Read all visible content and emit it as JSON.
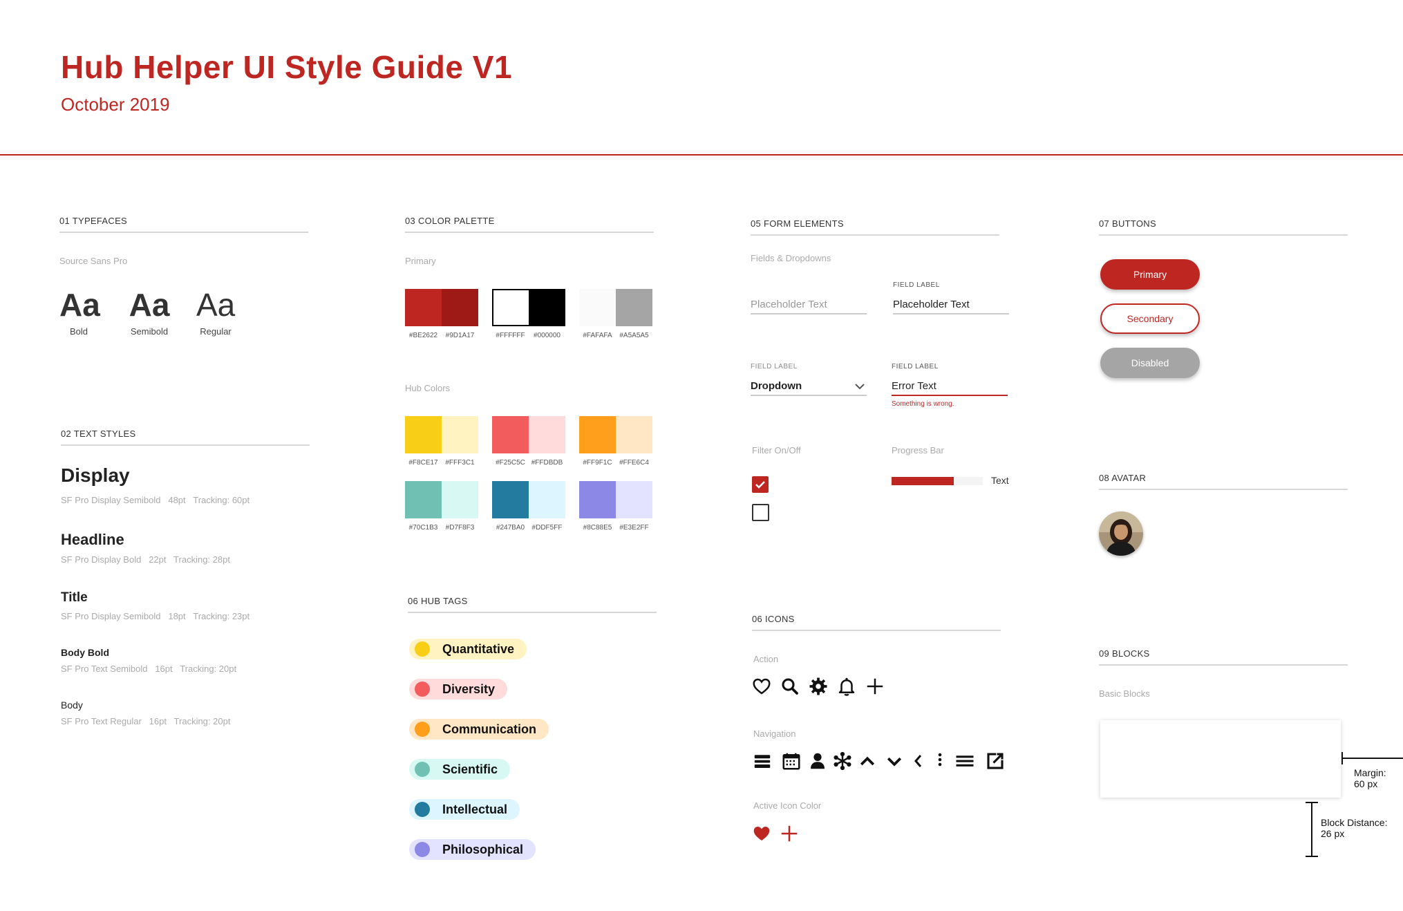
{
  "header": {
    "title": "Hub Helper UI Style Guide V1",
    "subtitle": "October 2019"
  },
  "typefaces": {
    "section": "01 TYPEFACES",
    "family": "Source Sans Pro",
    "samples": [
      {
        "glyph": "Aa",
        "label": "Bold"
      },
      {
        "glyph": "Aa",
        "label": "Semibold"
      },
      {
        "glyph": "Aa",
        "label": "Regular"
      }
    ]
  },
  "text_styles": {
    "section": "02 TEXT STYLES",
    "items": [
      {
        "name": "Display",
        "meta": "SF Pro Display Semibold   48pt   Tracking: 60pt"
      },
      {
        "name": "Headline",
        "meta": "SF Pro Display Bold   22pt   Tracking: 28pt"
      },
      {
        "name": "Title",
        "meta": "SF Pro Display Semibold   18pt   Tracking: 23pt"
      },
      {
        "name": "Body Bold",
        "meta": "SF Pro Text Semibold   16pt   Tracking: 20pt"
      },
      {
        "name": "Body",
        "meta": "SF Pro Text Regular   16pt   Tracking: 20pt"
      }
    ]
  },
  "palette": {
    "section": "03 COLOR PALETTE",
    "primary_label": "Primary",
    "primary": [
      {
        "a": "#BE2622",
        "b": "#9D1A17"
      },
      {
        "a": "#FFFFFF",
        "b": "#000000"
      },
      {
        "a": "#FAFAFA",
        "b": "#A5A5A5"
      }
    ],
    "hub_label": "Hub Colors",
    "hub": [
      {
        "a": "#F8CE17",
        "b": "#FFF3C1"
      },
      {
        "a": "#F25C5C",
        "b": "#FFDBDB"
      },
      {
        "a": "#FF9F1C",
        "b": "#FFE6C4"
      },
      {
        "a": "#70C1B3",
        "b": "#D7F8F3"
      },
      {
        "a": "#247BA0",
        "b": "#DDF5FF"
      },
      {
        "a": "#8C88E5",
        "b": "#E3E2FF"
      }
    ]
  },
  "hub_tags": {
    "section": "06 HUB TAGS",
    "items": [
      {
        "label": "Quantitative",
        "dot": "#F8CE17",
        "bg": "#FFF3C1"
      },
      {
        "label": "Diversity",
        "dot": "#F25C5C",
        "bg": "#FFDBDB"
      },
      {
        "label": "Communication",
        "dot": "#FF9F1C",
        "bg": "#FFE6C4"
      },
      {
        "label": "Scientific",
        "dot": "#70C1B3",
        "bg": "#D7F8F3"
      },
      {
        "label": "Intellectual",
        "dot": "#247BA0",
        "bg": "#DDF5FF"
      },
      {
        "label": "Philosophical",
        "dot": "#8C88E5",
        "bg": "#E3E2FF"
      }
    ]
  },
  "form": {
    "section": "05 FORM ELEMENTS",
    "fields_label": "Fields & Dropdowns",
    "placeholder": "Placeholder Text",
    "field_label": "FIELD LABEL",
    "filled_value": "Placeholder Text",
    "dropdown_label": "FIELD LABEL",
    "dropdown_value": "Dropdown",
    "error_label": "FIELD LABEL",
    "error_value": "Error Text",
    "error_message": "Something is wrong.",
    "filter_label": "Filter On/Off",
    "progress_label": "Progress Bar",
    "progress_text": "Text",
    "progress_value": 0.68
  },
  "icons": {
    "section": "06 ICONS",
    "action_label": "Action",
    "action": [
      "heart-icon",
      "search-icon",
      "gear-icon",
      "bell-icon",
      "plus-icon"
    ],
    "navigation_label": "Navigation",
    "navigation": [
      "stack-icon",
      "calendar-icon",
      "user-icon",
      "asterisk-icon",
      "chevron-up-icon",
      "chevron-down-icon",
      "chevron-left-icon",
      "more-vertical-icon",
      "menu-icon",
      "external-link-icon"
    ],
    "active_label": "Active Icon Color",
    "active_color": "#BE2622"
  },
  "buttons": {
    "section": "07 BUTTONS",
    "primary": "Primary",
    "secondary": "Secondary",
    "disabled": "Disabled"
  },
  "avatar": {
    "section": "08 AVATAR"
  },
  "blocks": {
    "section": "09 BLOCKS",
    "basic_label": "Basic Blocks",
    "margin_label": "Margin:",
    "margin_value": "60 px",
    "distance_label": "Block Distance:",
    "distance_value": "26 px"
  }
}
